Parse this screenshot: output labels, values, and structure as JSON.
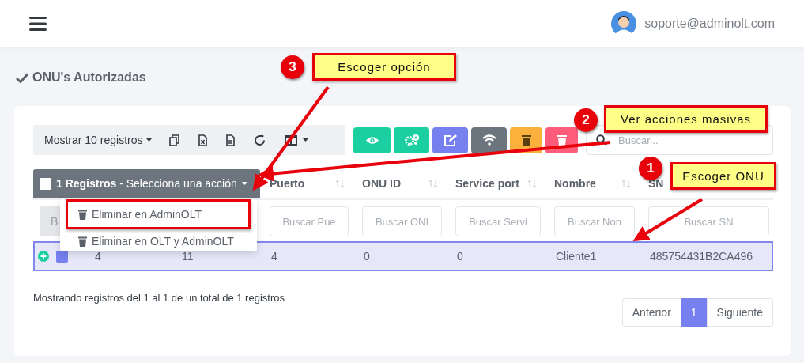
{
  "header": {
    "user_email": "soporte@adminolt.com"
  },
  "page_title": "ONU's Autorizadas",
  "toolbar": {
    "page_length": "Mostrar 10 registros",
    "export_buttons": [
      {
        "kind": "copy"
      },
      {
        "kind": "excel"
      },
      {
        "kind": "document"
      },
      {
        "kind": "refresh"
      },
      {
        "kind": "columns"
      }
    ],
    "action_buttons": [
      {
        "kind": "eye",
        "color": "#1ccfa0"
      },
      {
        "kind": "gears",
        "color": "#1ccfa0"
      },
      {
        "kind": "edit",
        "color": "#7680ee"
      },
      {
        "kind": "wifi",
        "color": "#6c757d"
      },
      {
        "kind": "trash",
        "color": "#fbb13c"
      },
      {
        "kind": "trash",
        "color": "#ff5c7c"
      }
    ]
  },
  "search": {
    "placeholder": "Buscar..."
  },
  "table": {
    "columns": [
      {
        "kind": "bulk",
        "text": "**1 Registros** - Selecciona una acción",
        "checked": false
      },
      {
        "kind": "under-bulk"
      },
      {
        "kind": "sort",
        "label": "Puerto",
        "sort_icon": true
      },
      {
        "kind": "sort",
        "label": "ONU ID",
        "sort_icon": true
      },
      {
        "kind": "sort",
        "label": "Service port",
        "sort_icon": true
      },
      {
        "kind": "sort",
        "label": "Nombre",
        "sort_icon": true
      },
      {
        "kind": "sort",
        "label": "SN",
        "sort_icon": false
      }
    ],
    "filters": [
      {
        "kind": "button",
        "placeholder": "B"
      },
      {
        "kind": "input",
        "placeholder": "Buscar Pue"
      },
      {
        "kind": "input",
        "placeholder": "Buscar ONI"
      },
      {
        "kind": "input",
        "placeholder": "Buscar Servi"
      },
      {
        "kind": "input",
        "placeholder": "Buscar Non"
      },
      {
        "kind": "input",
        "placeholder": "Buscar SN"
      }
    ],
    "rows": [
      {
        "selected": true,
        "checked": true,
        "cells": [
          "4",
          "11",
          "4",
          "0",
          "0",
          "Cliente1",
          "485754431B2CA496"
        ]
      }
    ]
  },
  "action_menu": {
    "items": [
      {
        "label": "Eliminar en AdminOLT",
        "highlighted": true
      },
      {
        "label": "Eliminar en OLT y AdminOLT",
        "highlighted": false
      }
    ]
  },
  "info": "Mostrando registros del 1 al 1 de un total de 1 registros",
  "pagination": [
    {
      "label": "Anterior",
      "selected": false
    },
    {
      "label": "1",
      "selected": true
    },
    {
      "label": "Siguiente",
      "selected": false
    }
  ],
  "annotations": [
    {
      "number": "3",
      "text": "Escoger opción"
    },
    {
      "number": "2",
      "text": "Ver acciones masivas"
    },
    {
      "number": "1",
      "text": "Escoger ONU"
    }
  ]
}
